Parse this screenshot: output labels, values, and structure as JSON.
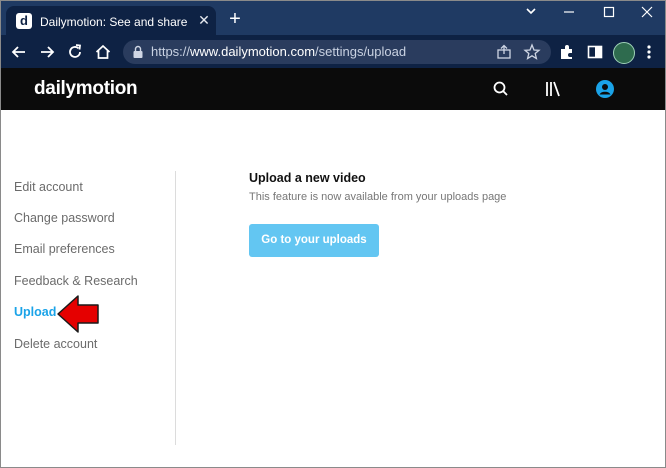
{
  "browser": {
    "tab": {
      "favicon_letter": "d",
      "title": "Dailymotion: See and share the in",
      "close_glyph": "✕"
    },
    "new_tab_glyph": "+",
    "url": {
      "scheme": "https://",
      "host": "www.dailymotion.com",
      "path": "/settings/upload"
    }
  },
  "site": {
    "logo": "dailymotion"
  },
  "sidebar": {
    "items": [
      {
        "label": "Edit account"
      },
      {
        "label": "Change password"
      },
      {
        "label": "Email preferences"
      },
      {
        "label": "Feedback & Research"
      },
      {
        "label": "Upload",
        "active": true
      },
      {
        "label": "Delete account"
      }
    ]
  },
  "main": {
    "title": "Upload a new video",
    "subtitle": "This feature is now available from your uploads page",
    "button_label": "Go to your uploads"
  },
  "colors": {
    "tab_bar": "#1f3a63",
    "toolbar": "#0e2244",
    "site_header": "#0b0b0b",
    "active_link": "#1aa3e8",
    "button": "#63c6f2",
    "annotation_arrow": "#e50000"
  }
}
